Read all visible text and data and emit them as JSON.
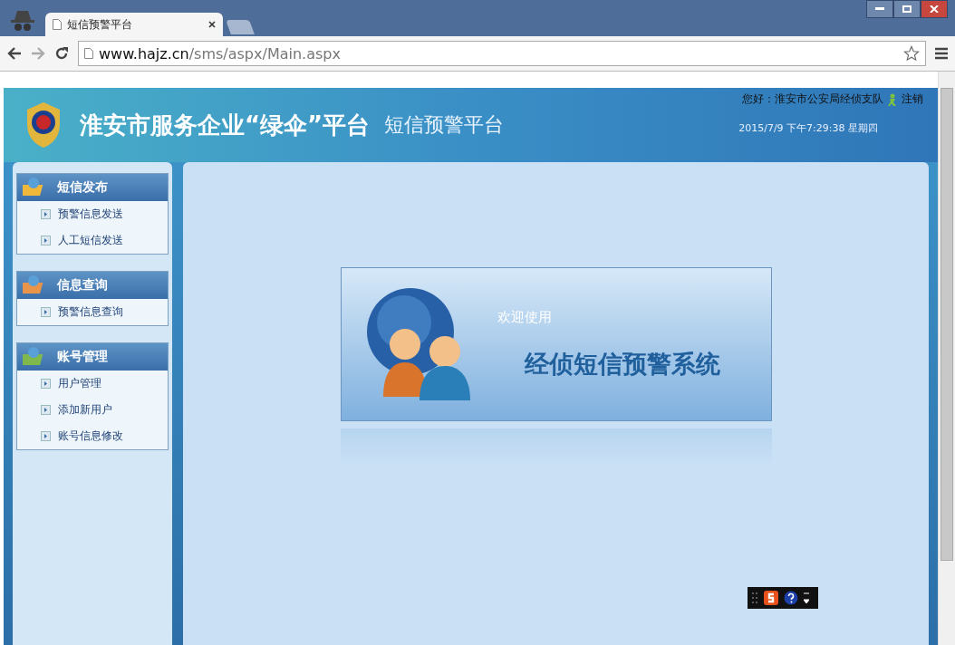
{
  "browser": {
    "tab_title": "短信预警平台",
    "url_host": "www.hajz.cn",
    "url_path": "/sms/aspx/Main.aspx"
  },
  "header": {
    "title": "淮安市服务企业“绿伞”平台",
    "subtitle": "短信预警平台",
    "greeting": "您好：淮安市公安局经侦支队",
    "logout": "注销",
    "datetime": "2015/7/9 下午7:29:38 星期四"
  },
  "sidebar": [
    {
      "title": "短信发布",
      "items": [
        "预警信息发送",
        "人工短信发送"
      ]
    },
    {
      "title": "信息查询",
      "items": [
        "预警信息查询"
      ]
    },
    {
      "title": "账号管理",
      "items": [
        "用户管理",
        "添加新用户",
        "账号信息修改"
      ]
    }
  ],
  "welcome": {
    "greeting": "欢迎使用",
    "system_name": "经侦短信预警系统"
  }
}
